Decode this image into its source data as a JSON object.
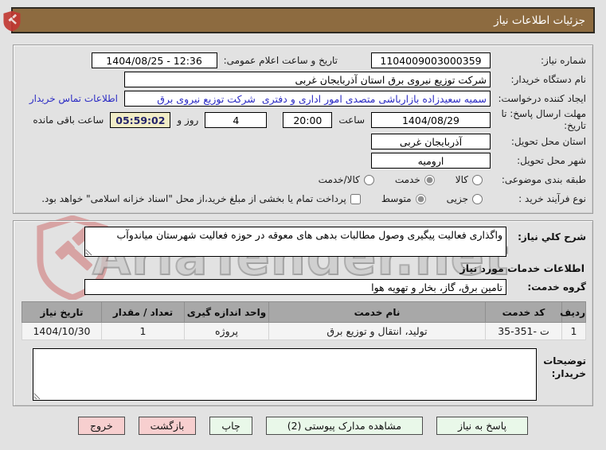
{
  "colors": {
    "titlebar_bg": "#8d6b40",
    "countdown_bg": "#f2edc6",
    "link_blue": "#2b2bc4",
    "button_pink": "#f7cfcf",
    "button_mint": "#e9f8e9",
    "watermark_red": "#c94f4f"
  },
  "header": {
    "title": "جزئیات اطلاعات نیاز"
  },
  "watermark": {
    "text": "AriaTender.net",
    "logo": "shield-gavel-logo"
  },
  "form": {
    "need_number": {
      "label": "شماره نیاز:",
      "value": "1104009003000359"
    },
    "publish_datetime": {
      "label": "تاریخ و ساعت اعلام عمومی:",
      "value": "1404/08/25 - 12:36"
    },
    "buyer_org": {
      "label": "نام دستگاه خریدار:",
      "value": "شرکت توزیع نیروی برق استان آذربایجان غربی"
    },
    "request_creator": {
      "label": "ایجاد کننده درخواست:",
      "value": "سمیه سعیدزاده بازارباشی متصدی امور اداری و دفتری  شرکت توزیع نیروی برق",
      "contact_link": "اطلاعات تماس خریدار"
    },
    "deadline": {
      "label": "مهلت ارسال پاسخ: تا تاریخ:",
      "date": "1404/08/29",
      "time_label": "ساعت",
      "time": "20:00",
      "days": "4",
      "days_label": "روز و",
      "countdown": "05:59:02",
      "countdown_label": "ساعت باقی مانده"
    },
    "province": {
      "label": "استان محل تحویل:",
      "value": "آذربایجان غربی"
    },
    "city": {
      "label": "شهر محل تحویل:",
      "value": "ارومیه"
    },
    "category": {
      "label": "طبقه بندی موضوعی:",
      "options": [
        {
          "label": "کالا",
          "checked": false
        },
        {
          "label": "خدمت",
          "checked": true
        },
        {
          "label": "کالا/خدمت",
          "checked": false
        }
      ]
    },
    "purchase_type": {
      "label": "نوع فرآیند خرید :",
      "options": [
        {
          "label": "جزیی",
          "checked": false
        },
        {
          "label": "متوسط",
          "checked": true
        }
      ],
      "treasury_checkbox": {
        "label": "پرداخت تمام یا بخشی از مبلغ خرید،از محل \"اسناد خزانه اسلامی\" خواهد بود.",
        "checked": false
      }
    }
  },
  "description": {
    "label": "شرح کلي نیاز:",
    "value": "واگذاری فعالیت پیگیری وصول مطالبات بدهی های معوقه در حوزه فعالیت شهرستان میاندوآب"
  },
  "services_section": {
    "title": "اطلاعات خدمات مورد نیاز",
    "service_group": {
      "label": "گروه خدمت:",
      "value": "تامین برق، گاز، بخار و تهویه هوا"
    }
  },
  "table": {
    "headers": [
      "ردیف",
      "کد خدمت",
      "نام خدمت",
      "واحد اندازه گیری",
      "تعداد / مقدار",
      "تاریخ نیاز"
    ],
    "rows": [
      [
        "1",
        "ت -351-35",
        "تولید، انتقال و توزیع برق",
        "پروژه",
        "1",
        "1404/10/30"
      ]
    ]
  },
  "buyer_notes": {
    "label": "توضیحات خریدار:",
    "value": ""
  },
  "buttons": {
    "respond": "پاسخ به نیاز",
    "attachments": "مشاهده مدارک پیوستی (2)",
    "print": "چاپ",
    "back": "بازگشت",
    "exit": "خروج"
  }
}
